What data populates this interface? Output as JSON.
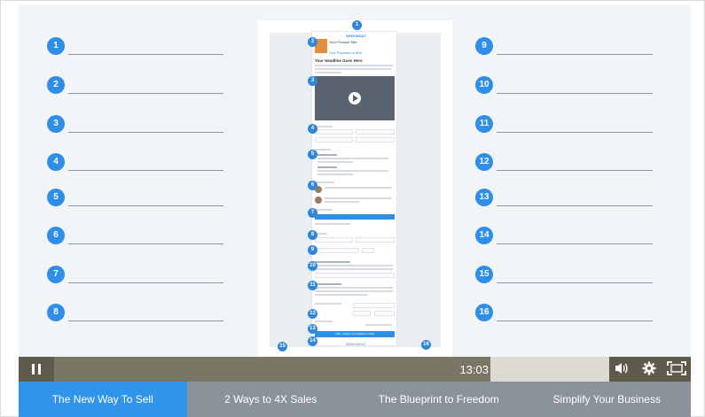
{
  "left_numbers": [
    "1",
    "2",
    "3",
    "4",
    "5",
    "6",
    "7",
    "8"
  ],
  "right_numbers": [
    "9",
    "10",
    "11",
    "12",
    "13",
    "14",
    "15",
    "16"
  ],
  "mockup": {
    "brand": "SEEKWHAT",
    "product_title": "Your Product Title",
    "price_line": "One Payment of $99",
    "headline": "Your Headline Goes Here",
    "callout_numbers": [
      "1",
      "2",
      "3",
      "4",
      "5",
      "6",
      "7",
      "8",
      "9",
      "10",
      "11",
      "12",
      "13",
      "14",
      "15",
      "16"
    ],
    "submit_label": "YES, I WANT TO ENROLL NOW",
    "footer_brand": "SEEKWHAT"
  },
  "player": {
    "time": "13:03",
    "pause_icon": "pause-icon",
    "volume_icon": "volume-icon",
    "settings_icon": "gear-icon",
    "fullscreen_icon": "fullscreen-icon",
    "progress": 0.7
  },
  "chapters": [
    {
      "label": "The New Way To Sell",
      "active": true
    },
    {
      "label": "2 Ways to 4X Sales",
      "active": false
    },
    {
      "label": "The Blueprint to Freedom",
      "active": false
    },
    {
      "label": "Simplify Your Business",
      "active": false
    }
  ],
  "colors": {
    "accent": "#2f94ea",
    "tab_inactive": "#8a939b",
    "control_bar": "#7a7666"
  }
}
